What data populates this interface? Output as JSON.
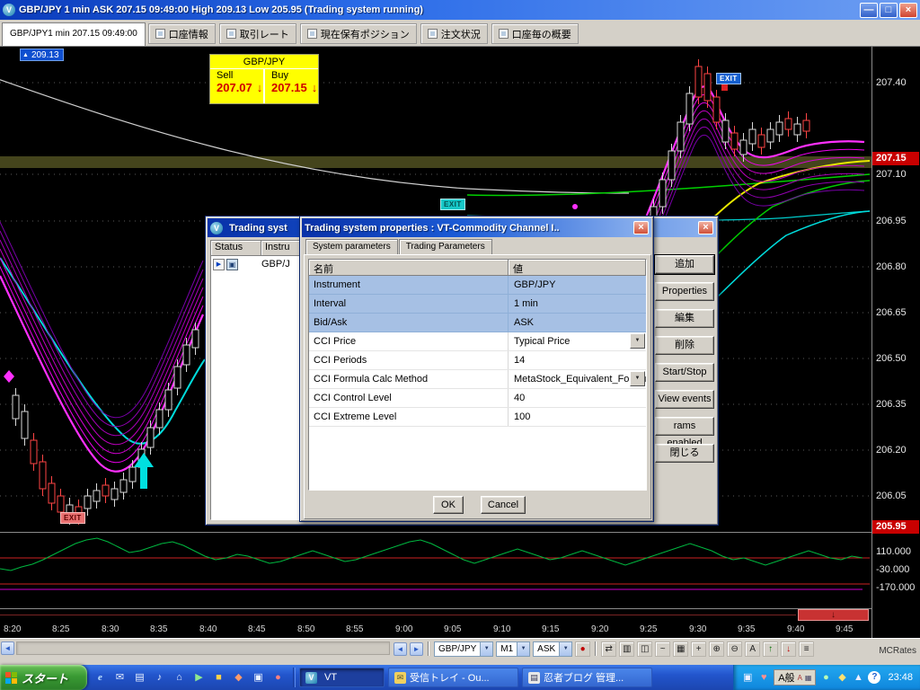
{
  "title_bar": {
    "title": "GBP/JPY 1 min ASK 207.15 09:49:00 High 209.13 Low 205.95 (Trading system running)"
  },
  "tab_bar": {
    "active": "GBP/JPY1 min 207.15 09:49:00",
    "tabs": [
      "口座情報",
      "取引レート",
      "現在保有ポジション",
      "注文状況",
      "口座毎の概要"
    ]
  },
  "chart": {
    "high_marker": "209.13",
    "exit_label": "EXIT",
    "quote_box": {
      "title": "GBP/JPY",
      "sell_label": "Sell",
      "buy_label": "Buy",
      "sell": "207.07",
      "buy": "207.15"
    },
    "price_axis": {
      "labels": [
        "207.40",
        "207.10",
        "206.95",
        "206.80",
        "206.65",
        "206.50",
        "206.35",
        "206.20",
        "206.05"
      ],
      "current": "207.15",
      "low": "205.95"
    },
    "indicator_axis": [
      "110.000",
      "-30.000",
      "-170.000"
    ],
    "time_axis": [
      "8:20",
      "8:25",
      "8:30",
      "8:35",
      "8:40",
      "8:45",
      "8:50",
      "8:55",
      "9:00",
      "9:05",
      "9:10",
      "9:15",
      "9:20",
      "9:25",
      "9:30",
      "9:35",
      "9:40",
      "9:45"
    ]
  },
  "systems_window": {
    "title": "Trading syst",
    "columns": {
      "status": "Status",
      "instrument": "Instru"
    },
    "row": {
      "instrument": "GBP/J"
    },
    "buttons": [
      "追加",
      "Properties",
      "編集",
      "削除",
      "Start/Stop",
      "View events",
      "rams enabled",
      "閉じる"
    ]
  },
  "dialog": {
    "title": "Trading system properties : VT-Commodity Channel I..",
    "tabs": [
      "System parameters",
      "Trading Parameters"
    ],
    "columns": {
      "name": "名前",
      "value": "値"
    },
    "rows": [
      {
        "name": "Instrument",
        "value": "GBP/JPY"
      },
      {
        "name": "Interval",
        "value": "1 min"
      },
      {
        "name": "Bid/Ask",
        "value": "ASK"
      },
      {
        "name": "CCI Price",
        "value": "Typical Price"
      },
      {
        "name": "CCI Periods",
        "value": "14"
      },
      {
        "name": "CCI Formula Calc Method",
        "value": "MetaStock_Equivalent_Formu"
      },
      {
        "name": "CCI Control Level",
        "value": "40"
      },
      {
        "name": "CCI Extreme Level",
        "value": "100"
      }
    ],
    "ok": "OK",
    "cancel": "Cancel"
  },
  "bottom_toolbar": {
    "symbol": "GBP/JPY",
    "timeframe": "M1",
    "price_type": "ASK",
    "brand": "MCRates"
  },
  "taskbar": {
    "start": "スタート",
    "windows": [
      "VT",
      "受信トレイ - Ou...",
      "忍者ブログ 管理..."
    ],
    "ime": "A般",
    "clock": "23:48"
  },
  "icons": {
    "minimize": "—",
    "restore": "□",
    "close": "×",
    "dropdown": "▼",
    "down": "↓",
    "up": "↑",
    "left": "◄",
    "right": "►",
    "play": "▶",
    "monitor": "▣",
    "dot": "●",
    "shift": "⇄",
    "bars": "▥",
    "candles": "◫",
    "grid": "▦",
    "line": "~",
    "cursor": "+",
    "zoom_in": "⊕",
    "zoom_out": "⊖",
    "text": "A",
    "list": "≡",
    "mail": "✉",
    "home": "⌂",
    "ie": "e",
    "doc": "▤",
    "note": "♪",
    "square": "■",
    "diamond": "◆",
    "tri": "▲",
    "question": "?",
    "heart": "♥"
  }
}
